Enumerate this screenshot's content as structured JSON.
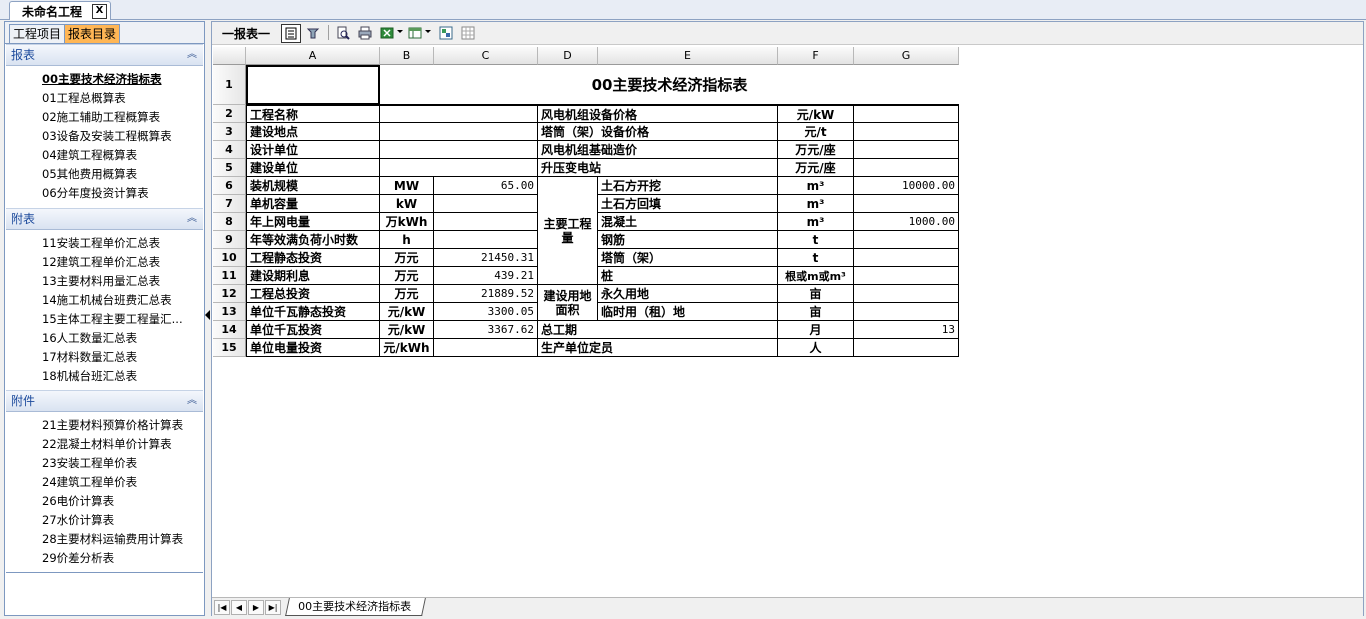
{
  "doc_tab": {
    "label": "未命名工程",
    "close": "X"
  },
  "left_tabs": [
    "工程项目",
    "报表目录"
  ],
  "sections": [
    {
      "title": "报表",
      "collapse": "︽",
      "items": [
        "00主要技术经济指标表",
        "01工程总概算表",
        "02施工辅助工程概算表",
        "03设备及安装工程概算表",
        "04建筑工程概算表",
        "05其他费用概算表",
        "06分年度投资计算表"
      ]
    },
    {
      "title": "附表",
      "collapse": "︽",
      "items": [
        "11安装工程单价汇总表",
        "12建筑工程单价汇总表",
        "13主要材料用量汇总表",
        "14施工机械台班费汇总表",
        "15主体工程主要工程量汇...",
        "16人工数量汇总表",
        "17材料数量汇总表",
        "18机械台班汇总表"
      ]
    },
    {
      "title": "附件",
      "collapse": "︽",
      "items": [
        "21主要材料预算价格计算表",
        "22混凝土材料单价计算表",
        "23安装工程单价表",
        "24建筑工程单价表",
        "26电价计算表",
        "27水价计算表",
        "28主要材料运输费用计算表",
        "29价差分析表"
      ]
    }
  ],
  "toolbar": {
    "label": "一报表一"
  },
  "columns": [
    "A",
    "B",
    "C",
    "D",
    "E",
    "F",
    "G"
  ],
  "rows": [
    "1",
    "2",
    "3",
    "4",
    "5",
    "6",
    "7",
    "8",
    "9",
    "10",
    "11",
    "12",
    "13",
    "14",
    "15"
  ],
  "sheet": {
    "title": "00主要技术经济指标表",
    "r2": {
      "a": "工程名称",
      "d": "风电机组设备价格",
      "f": "元/kW"
    },
    "r3": {
      "a": "建设地点",
      "d": "塔筒（架）设备价格",
      "f": "元/t"
    },
    "r4": {
      "a": "设计单位",
      "d": "风电机组基础造价",
      "f": "万元/座"
    },
    "r5": {
      "a": "建设单位",
      "d": "升压变电站",
      "f": "万元/座"
    },
    "r6": {
      "a": "装机规模",
      "b": "MW",
      "c": "65.00",
      "e": "土石方开挖",
      "f": "m³",
      "g": "10000.00"
    },
    "r7": {
      "a": "单机容量",
      "b": "kW",
      "e": "土石方回填",
      "f": "m³"
    },
    "r8": {
      "a": "年上网电量",
      "b": "万kWh",
      "e": "混凝土",
      "f": "m³",
      "g": "1000.00"
    },
    "r9": {
      "a": "年等效满负荷小时数",
      "b": "h",
      "e": "钢筋",
      "f": "t"
    },
    "r10": {
      "a": "工程静态投资",
      "b": "万元",
      "c": "21450.31",
      "e": "塔筒（架）",
      "f": "t"
    },
    "r11": {
      "a": "建设期利息",
      "b": "万元",
      "c": "439.21",
      "e": "桩",
      "f": "根或m或m³"
    },
    "r12": {
      "a": "工程总投资",
      "b": "万元",
      "c": "21889.52",
      "e": "永久用地",
      "f": "亩"
    },
    "r13": {
      "a": "单位千瓦静态投资",
      "b": "元/kW",
      "c": "3300.05",
      "e": "临时用（租）地",
      "f": "亩"
    },
    "r14": {
      "a": "单位千瓦投资",
      "b": "元/kW",
      "c": "3367.62",
      "d": "总工期",
      "f": "月",
      "g": "13"
    },
    "r15": {
      "a": "单位电量投资",
      "b": "元/kWh",
      "d": "生产单位定员",
      "f": "人"
    },
    "d6": "主要工程量",
    "d12": "建设用地面积"
  },
  "sheet_tab": "00主要技术经济指标表",
  "nav": [
    "|◀",
    "◀",
    "▶",
    "▶|"
  ]
}
